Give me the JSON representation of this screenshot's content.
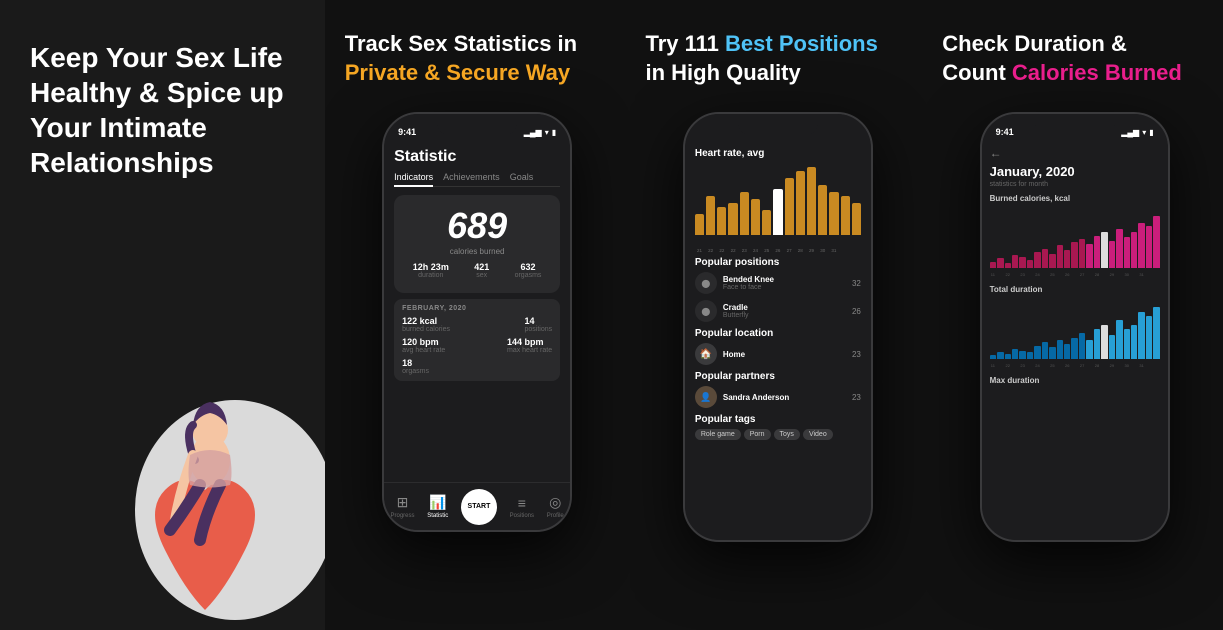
{
  "panels": [
    {
      "id": "panel-1",
      "headline_line1": "Keep Your Sex Life",
      "headline_line2": "Healthy & Spice up",
      "headline_line3": "Your Intimate",
      "headline_line4": "Relationships",
      "bg": "#1a1a1a"
    },
    {
      "id": "panel-2",
      "headline": "Track Sex Statistics in",
      "headline_accent": "Private & Secure Way",
      "phone": {
        "time": "9:41",
        "screen_title": "Statistic",
        "tabs": [
          "Indicators",
          "Achievements",
          "Goals"
        ],
        "active_tab": 0,
        "big_number": "689",
        "big_label": "calories burned",
        "stats": [
          {
            "val": "12h 23m",
            "label": "duration"
          },
          {
            "val": "421",
            "label": "sex"
          },
          {
            "val": "632",
            "label": "orgasms"
          }
        ],
        "section_title": "FEBRUARY, 2020",
        "section_rows": [
          [
            {
              "val": "122 kcal",
              "label": "burned calories"
            },
            {
              "val": "14",
              "label": "positions"
            }
          ],
          [
            {
              "val": "120 bpm",
              "label": "avg heart rate"
            },
            {
              "val": "144 bpm",
              "label": "max heart rate"
            }
          ]
        ],
        "orgasms": "18",
        "orgasms_label": "orgasms",
        "nav": [
          "Progress",
          "Statistic",
          "START",
          "Positions",
          "Profile"
        ]
      }
    },
    {
      "id": "panel-3",
      "headline": "Try 111 ",
      "headline_accent": "Best Positions",
      "headline_rest": "in High Quality",
      "phone": {
        "chart_title": "Heart rate, avg",
        "bar_values": [
          30,
          55,
          40,
          45,
          60,
          50,
          35,
          65,
          80,
          90,
          95,
          70,
          60,
          55,
          45
        ],
        "bar_labels": [
          "21",
          "22",
          "22",
          "22",
          "23",
          "24",
          "25",
          "26",
          "27",
          "28",
          "29",
          "30",
          "31",
          "",
          ""
        ],
        "highlight_bar": 7,
        "popular_positions_title": "Popular positions",
        "positions": [
          {
            "name": "Bended Knee",
            "sub": "Face to face",
            "count": "32"
          },
          {
            "name": "Cradle",
            "sub": "Butterfly",
            "count": "26"
          }
        ],
        "popular_location_title": "Popular location",
        "location": {
          "name": "Home",
          "count": "23"
        },
        "popular_partners_title": "Popular partners",
        "partner": {
          "name": "Sandra Anderson",
          "count": "23"
        },
        "popular_tags_title": "Popular tags",
        "tags": [
          "Role game",
          "Porn",
          "Toys",
          "Video"
        ]
      }
    },
    {
      "id": "panel-4",
      "headline": "Check Duration &",
      "headline_line2": "Count ",
      "headline_accent": "Calories Burned",
      "phone": {
        "time": "9:41",
        "back": "←",
        "month": "January, 2020",
        "month_sub": "statistics for month",
        "section1_title": "Burned calories, kcal",
        "bar_colors_1": "pink",
        "bar_values_1": [
          10,
          15,
          8,
          20,
          18,
          12,
          25,
          30,
          22,
          35,
          28,
          40,
          45,
          38,
          50,
          55,
          42,
          60,
          48,
          55,
          70,
          65,
          80
        ],
        "bar_labels_1": [
          "11",
          "22",
          "23",
          "24",
          "25",
          "26",
          "27",
          "28",
          "29",
          "30",
          "31"
        ],
        "highlight_1": 15,
        "section2_title": "Total duration",
        "bar_values_2": [
          5,
          8,
          6,
          12,
          10,
          8,
          15,
          20,
          14,
          22,
          18,
          25,
          30,
          22,
          35,
          40,
          28,
          45,
          35,
          40,
          55,
          50,
          60
        ],
        "bar_labels_2": [
          "11",
          "22",
          "23",
          "24",
          "25",
          "26",
          "27",
          "28",
          "29",
          "30",
          "31"
        ],
        "highlight_2": 15,
        "section3_title": "Max duration"
      }
    }
  ]
}
